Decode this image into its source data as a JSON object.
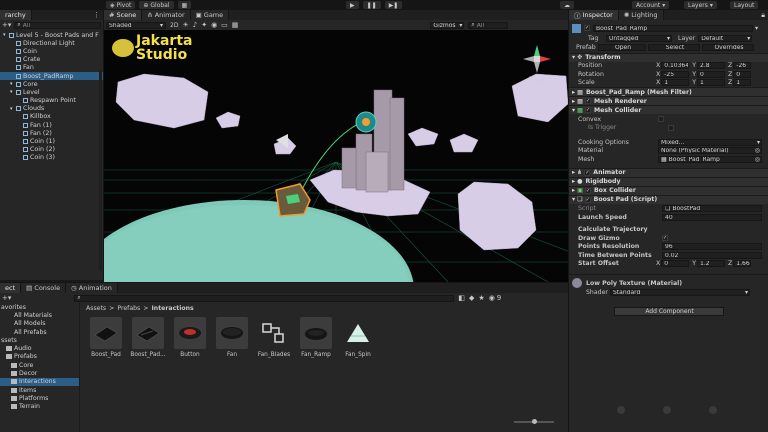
{
  "toolbar": {
    "pivot": "Pivot",
    "global": "Global",
    "account": "Account",
    "layers": "Layers",
    "layout": "Layout"
  },
  "hierarchy": {
    "tab": "rarchy",
    "search_placeholder": "All",
    "items": [
      {
        "label": "Level 5 - Boost Pads and F",
        "indent": 0,
        "selected": false
      },
      {
        "label": "Directional Light",
        "indent": 1,
        "selected": false
      },
      {
        "label": "Coin",
        "indent": 1,
        "selected": false
      },
      {
        "label": "Crate",
        "indent": 1,
        "selected": false
      },
      {
        "label": "Fan",
        "indent": 1,
        "selected": false
      },
      {
        "label": "Boost_PadRamp",
        "indent": 1,
        "selected": true
      },
      {
        "label": "Core",
        "indent": 1,
        "selected": false
      },
      {
        "label": "Level",
        "indent": 1,
        "selected": false
      },
      {
        "label": "Respawn Point",
        "indent": 2,
        "selected": false
      },
      {
        "label": "Clouds",
        "indent": 1,
        "selected": false
      },
      {
        "label": "Killbox",
        "indent": 2,
        "selected": false
      },
      {
        "label": "Fan (1)",
        "indent": 2,
        "selected": false
      },
      {
        "label": "Fan (2)",
        "indent": 2,
        "selected": false
      },
      {
        "label": "Coin (1)",
        "indent": 2,
        "selected": false
      },
      {
        "label": "Coin (2)",
        "indent": 2,
        "selected": false
      },
      {
        "label": "Coin (3)",
        "indent": 2,
        "selected": false
      }
    ]
  },
  "scene": {
    "tabs": [
      "Scene",
      "Animator",
      "Game"
    ],
    "shading": "Shaded",
    "mode_2d": "2D",
    "gizmos": "Gizmos",
    "gizmo_search": "All",
    "persp": "Persp",
    "watermark_line1": "Jakarta",
    "watermark_line2": "Studio"
  },
  "inspector": {
    "tabs": [
      "Inspector",
      "Lighting"
    ],
    "object_name": "Boost_Pad_Ramp",
    "tag_label": "Tag",
    "tag_value": "Untagged",
    "layer_label": "Layer",
    "layer_value": "Default",
    "prefab_label": "Prefab",
    "prefab_open": "Open",
    "prefab_select": "Select",
    "prefab_overrides": "Overrides",
    "transform": {
      "title": "Transform",
      "position_label": "Position",
      "rotation_label": "Rotation",
      "scale_label": "Scale",
      "position": {
        "x": "0.1036420",
        "y": "2.8",
        "z": "-26"
      },
      "rotation": {
        "x": "-25",
        "y": "0",
        "z": "0"
      },
      "scale": {
        "x": "1",
        "y": "1",
        "z": "1"
      }
    },
    "mesh_filter": "Boost_Pad_Ramp (Mesh Filter)",
    "mesh_renderer": "Mesh Renderer",
    "mesh_collider": {
      "title": "Mesh Collider",
      "convex": "Convex",
      "is_trigger": "Is Trigger",
      "cooking_label": "Cooking Options",
      "cooking_value": "Mixed...",
      "material_label": "Material",
      "material_value": "None (Physic Material)",
      "mesh_label": "Mesh",
      "mesh_value": "Boost_Pad_Ramp"
    },
    "animator": "Animator",
    "rigidbody": "Rigidbody",
    "box_collider": "Box Collider",
    "boost_pad": {
      "title": "Boost Pad (Script)",
      "script_label": "Script",
      "script_value": "BoostPad",
      "launch_label": "Launch Speed",
      "launch_value": "40",
      "calc_header": "Calculate Trajectory",
      "draw_gizmo": "Draw Gizmo",
      "points_res_label": "Points Resolution",
      "points_res_value": "96",
      "time_label": "Time Between Points",
      "time_value": "0.02",
      "offset_label": "Start Offset",
      "offset": {
        "x": "0",
        "y": "1.2",
        "z": "1.66"
      }
    },
    "material_name": "Low Poly Texture (Material)",
    "shader_label": "Shader",
    "shader_value": "Standard",
    "add_component": "Add Component"
  },
  "project": {
    "tabs": [
      "ect",
      "Console",
      "Animation"
    ],
    "breadcrumb": [
      "Assets",
      "Prefabs",
      "Interactions"
    ],
    "tree": [
      {
        "label": "avorites",
        "indent": 0,
        "selected": false
      },
      {
        "label": "All Materials",
        "indent": 1,
        "selected": false
      },
      {
        "label": "All Models",
        "indent": 1,
        "selected": false
      },
      {
        "label": "All Prefabs",
        "indent": 1,
        "selected": false
      },
      {
        "label": "ssets",
        "indent": 0,
        "selected": false
      },
      {
        "label": "Audio",
        "indent": 1,
        "selected": false
      },
      {
        "label": "Prefabs",
        "indent": 1,
        "selected": false
      },
      {
        "label": "Core",
        "indent": 2,
        "selected": false
      },
      {
        "label": "Decor",
        "indent": 2,
        "selected": false
      },
      {
        "label": "Interactions",
        "indent": 2,
        "selected": true
      },
      {
        "label": "Items",
        "indent": 2,
        "selected": false
      },
      {
        "label": "Platforms",
        "indent": 2,
        "selected": false
      },
      {
        "label": "Terrain",
        "indent": 2,
        "selected": false
      }
    ],
    "assets": [
      "Boost_Pad",
      "Boost_Pad...",
      "Button",
      "Fan",
      "Fan_Blades",
      "Fan_Ramp",
      "Fan_Spin"
    ],
    "asset_count": "9"
  },
  "colors": {
    "accent": "#2c5d87",
    "panel": "#262626",
    "scene_bg": "#050505",
    "cloud": "#d8cde6",
    "ground": "#7fc9b8",
    "grid": "#1e6e4e"
  }
}
